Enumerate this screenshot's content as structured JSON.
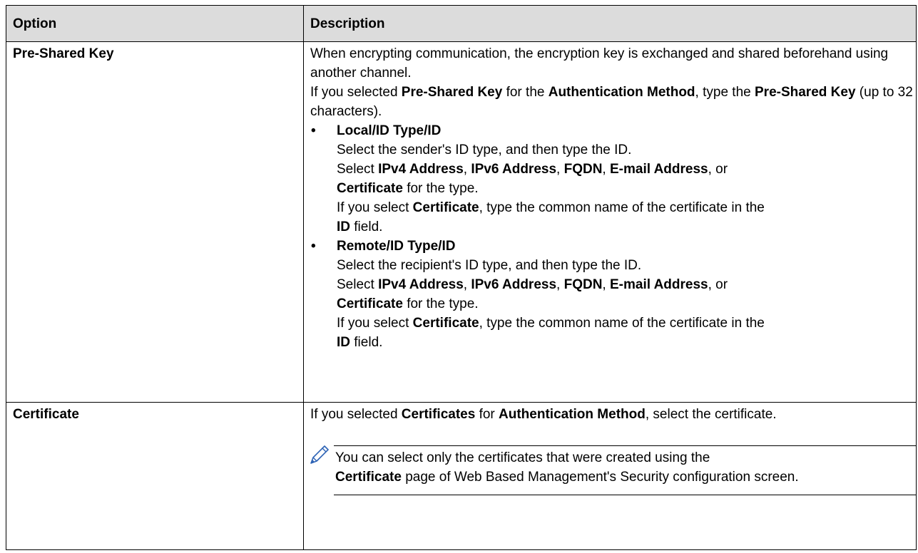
{
  "header": {
    "col1": "Option",
    "col2": "Description"
  },
  "row1": {
    "option": "Pre-Shared Key",
    "intro": "When encrypting communication, the encryption key is exchanged and shared beforehand using another channel.",
    "p2": {
      "a": "If you selected ",
      "b1": "Pre-Shared Key",
      "c": " for the ",
      "b2": "Authentication Method",
      "d": ", type the ",
      "b3": "Pre-Shared Key",
      "e": " (up to 32 characters)."
    },
    "bullet_glyph": "•",
    "local": {
      "title": "Local/ID Type/ID",
      "line1": "Select the sender's ID type, and then type the ID.",
      "sel_a": "Select ",
      "ipv4": "IPv4 Address",
      "sep": ", ",
      "ipv6": "IPv6 Address",
      "fqdn": "FQDN",
      "email": "E-mail Address",
      "or": ", or ",
      "cert": "Certificate",
      "for_type": " for the type.",
      "if_sel": "If you select ",
      "type_common": ", type the common name of the certificate in the ",
      "id": "ID",
      "field": " field."
    },
    "remote": {
      "title": "Remote/ID Type/ID",
      "line1": "Select the recipient's ID type, and then type the ID.",
      "sel_a": "Select ",
      "ipv4": "IPv4 Address",
      "sep": ", ",
      "ipv6": "IPv6 Address",
      "fqdn": "FQDN",
      "email": "E-mail Address",
      "or": ", or ",
      "cert": "Certificate",
      "for_type": " for the type.",
      "if_sel": "If you select ",
      "type_common": ", type the common name of the certificate in the ",
      "id": "ID",
      "field": " field."
    }
  },
  "row2": {
    "option": "Certificate",
    "p1": {
      "a": "If you selected ",
      "b1": "Certificates",
      "c": " for ",
      "b2": "Authentication Method",
      "d": ", select the certificate."
    },
    "note": {
      "icon": "pencil-note-icon",
      "a": "You can select only the certificates that were created using the ",
      "b": "Certificate",
      "c": " page of Web Based Management's Security configuration screen."
    }
  }
}
